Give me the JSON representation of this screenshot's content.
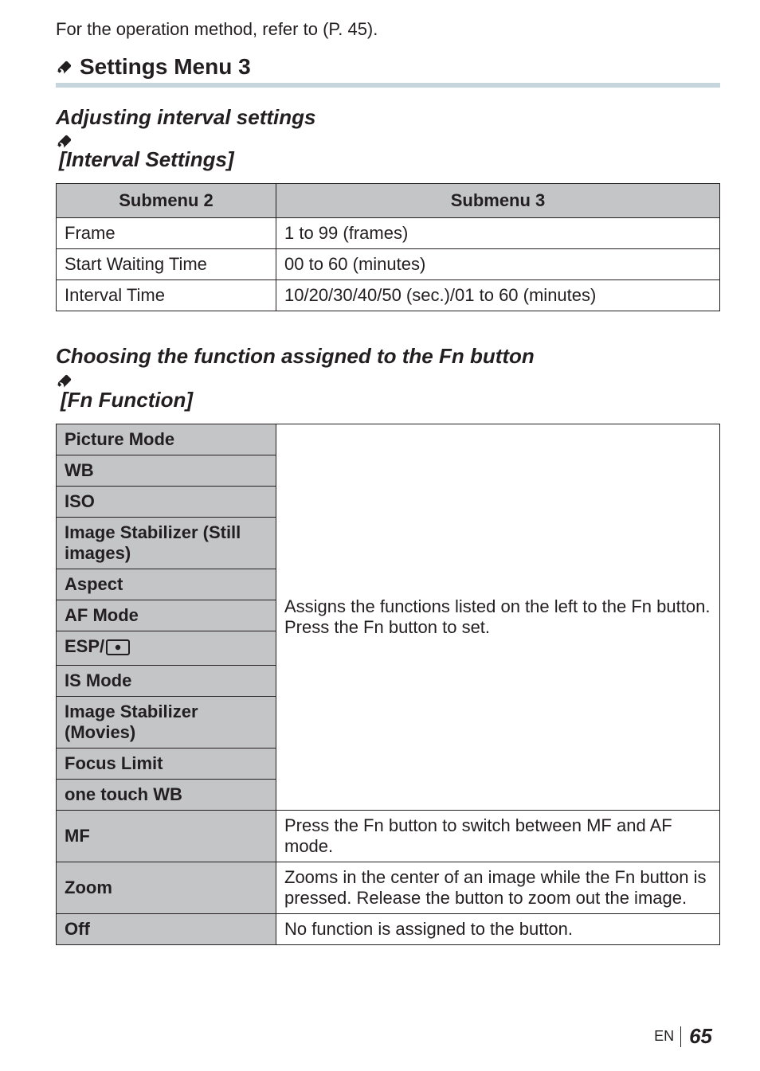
{
  "intro": "For the operation method, refer to (P. 45).",
  "section_heading": "Settings Menu 3",
  "subheading_interval": {
    "prefix": "Adjusting interval settings ",
    "bracket_open": "[",
    "title": "Interval Settings]"
  },
  "table1": {
    "head": {
      "c1": "Submenu 2",
      "c2": "Submenu 3"
    },
    "rows": [
      {
        "label": "Frame",
        "value": "1 to 99 (frames)"
      },
      {
        "label": "Start Waiting Time",
        "value": "00 to 60 (minutes)"
      },
      {
        "label": "Interval Time",
        "value": "10/20/30/40/50 (sec.)/01 to 60 (minutes)"
      }
    ]
  },
  "subheading_fn": {
    "line1": "Choosing the function assigned to the Fn button",
    "line2": "[Fn Function]"
  },
  "table2": {
    "options": [
      "Picture Mode",
      "WB",
      "ISO",
      "Image Stabilizer (Still images)",
      "Aspect",
      "AF Mode",
      "ESP/",
      "IS Mode",
      "Image Stabilizer (Movies)",
      "Focus Limit",
      "one touch WB"
    ],
    "assign_desc_l1": "Assigns the functions listed on the left to the Fn button.",
    "assign_desc_l2": "Press the Fn button to set.",
    "mf_label": "MF",
    "mf_desc": "Press the Fn button to switch between MF and AF mode.",
    "zoom_label": "Zoom",
    "zoom_desc": "Zooms in the center of an image while the Fn button is pressed. Release the button to zoom out the image.",
    "off_label": "Off",
    "off_desc": "No function is assigned to the button."
  },
  "footer": {
    "lang": "EN",
    "page": "65"
  },
  "icons": {
    "wrench": "wrench-icon",
    "metering": "spot-metering-icon"
  }
}
